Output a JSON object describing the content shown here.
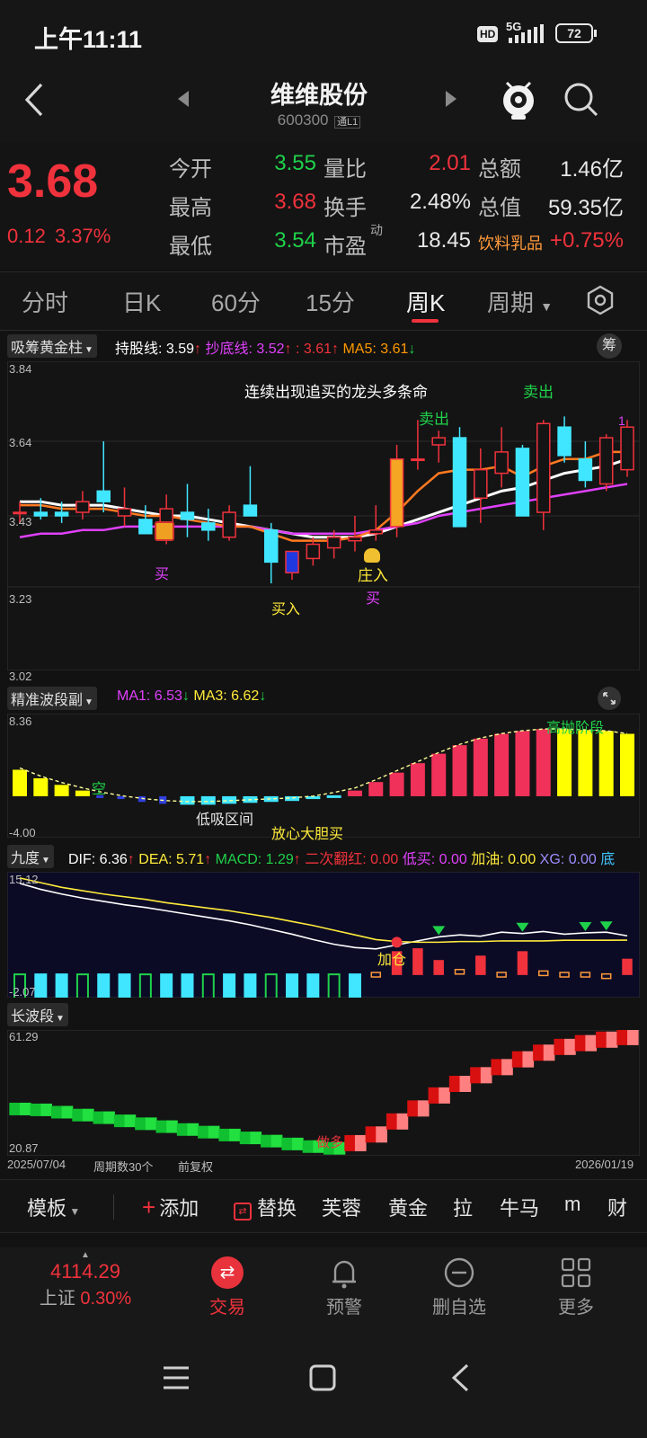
{
  "status": {
    "time": "上午11:11",
    "hd": "HD",
    "network": "5G",
    "battery": "72"
  },
  "nav": {
    "title": "维维股份",
    "code": "600300",
    "level": "通L1"
  },
  "quote": {
    "price": "3.68",
    "change": "0.12",
    "change_pct": "3.37%",
    "rows": [
      [
        {
          "l": "今开",
          "v": "3.55",
          "c": "green"
        },
        {
          "l": "量比",
          "v": "2.01",
          "c": "red"
        },
        {
          "l": "总额",
          "v": "1.46亿",
          "c": "white"
        }
      ],
      [
        {
          "l": "最高",
          "v": "3.68",
          "c": "red"
        },
        {
          "l": "换手",
          "v": "2.48%",
          "c": "white"
        },
        {
          "l": "总值",
          "v": "59.35亿",
          "c": "white"
        }
      ],
      [
        {
          "l": "最低",
          "v": "3.54",
          "c": "green"
        },
        {
          "l": "市盈",
          "v": "18.45",
          "c": "white"
        },
        {
          "l": "饮料乳品",
          "v": "+0.75%",
          "c": "red"
        }
      ]
    ],
    "pe_sup": "动"
  },
  "tabs": [
    "分时",
    "日K",
    "60分",
    "15分",
    "周K",
    "周期"
  ],
  "main_ind": {
    "name": "吸筹黄金柱",
    "items": [
      {
        "t": "持股线: 3.59",
        "c": "#ffffff"
      },
      {
        "t": "↑",
        "c": "#f0323c"
      },
      {
        "t": " 抄底线: 3.52",
        "c": "#e040fb"
      },
      {
        "t": "↑",
        "c": "#f0323c"
      },
      {
        "t": " : 3.61",
        "c": "#f0323c"
      },
      {
        "t": "↑",
        "c": "#f0323c"
      },
      {
        "t": " MA5: 3.61",
        "c": "#ff9800"
      },
      {
        "t": "↓",
        "c": "#1fd14a"
      }
    ],
    "chip": "筹",
    "axis": [
      "3.84",
      "3.64",
      "3.43",
      "3.23",
      "3.02"
    ],
    "annotations": {
      "headline": "连续出现追买的龙头多条命",
      "sell1": "卖出",
      "sell2": "卖出",
      "buy1": "买",
      "buy2": "买入",
      "zhuang": "庄入",
      "buy3": "买",
      "one": "1"
    }
  },
  "sub1": {
    "name": "精准波段副",
    "items": [
      {
        "t": "MA1: 6.53",
        "c": "#e040fb"
      },
      {
        "t": "↓",
        "c": "#1fd14a"
      },
      {
        "t": " MA3: 6.62",
        "c": "#ffeb3b"
      },
      {
        "t": "↓",
        "c": "#1fd14a"
      }
    ],
    "axis": [
      "8.36",
      "-4.00"
    ],
    "annotations": {
      "kong": "空",
      "low": "低吸区间",
      "bold": "放心大胆买",
      "high": "高抛阶段"
    }
  },
  "sub2": {
    "name": "九度",
    "items": [
      {
        "t": "DIF: 6.36",
        "c": "#ffffff"
      },
      {
        "t": "↑",
        "c": "#f0323c"
      },
      {
        "t": " DEA: 5.71",
        "c": "#ffeb3b"
      },
      {
        "t": "↑",
        "c": "#f0323c"
      },
      {
        "t": " MACD: 1.29",
        "c": "#1fd14a"
      },
      {
        "t": "↑",
        "c": "#f0323c"
      },
      {
        "t": " 二次翻红: 0.00",
        "c": "#f0323c"
      },
      {
        "t": " 低买: 0.00",
        "c": "#e040fb"
      },
      {
        "t": " 加油: 0.00",
        "c": "#ffeb3b"
      },
      {
        "t": " XG: 0.00",
        "c": "#9c8cff"
      },
      {
        "t": " 底",
        "c": "#40c4ff"
      }
    ],
    "axis": [
      "15.12",
      "-2.07"
    ],
    "annotations": {
      "jiacang": "加仓"
    }
  },
  "sub3": {
    "name": "长波段",
    "axis": [
      "61.29",
      "20.87"
    ],
    "annotations": {
      "zuoduo": "做多"
    }
  },
  "footer": {
    "start": "2025/07/04",
    "periods": "周期数30个",
    "adj": "前复权",
    "end": "2026/01/19"
  },
  "toolbar": [
    "模板",
    "添加",
    "替换",
    "芙蓉",
    "黄金",
    "拉",
    "牛马",
    "m",
    "财"
  ],
  "bottom": {
    "index_value": "4114.29",
    "index_name": "上证",
    "index_pct": "0.30%",
    "trade": "交易",
    "alert": "预警",
    "remove": "删自选",
    "more": "更多"
  },
  "colors": {
    "up": "#f0323c",
    "down": "#1fd14a",
    "cyan": "#40e6ff",
    "magenta": "#e040fb",
    "yellow": "#ffff00"
  },
  "chart_data": [
    {
      "type": "candlestick",
      "title": "周K",
      "ylim": [
        3.02,
        3.84
      ],
      "x": [
        "2025/07/04",
        "",
        "",
        "",
        "",
        "",
        "",
        "",
        "",
        "",
        "",
        "",
        "",
        "",
        "",
        "",
        "",
        "",
        "",
        "",
        "",
        "",
        "",
        "",
        "",
        "",
        "",
        "",
        "",
        "2026/01/19"
      ],
      "ohlc": [
        [
          3.44,
          3.47,
          3.41,
          3.44
        ],
        [
          3.44,
          3.48,
          3.42,
          3.43
        ],
        [
          3.44,
          3.47,
          3.41,
          3.43
        ],
        [
          3.44,
          3.5,
          3.42,
          3.47
        ],
        [
          3.5,
          3.64,
          3.44,
          3.47
        ],
        [
          3.43,
          3.51,
          3.4,
          3.45
        ],
        [
          3.42,
          3.46,
          3.38,
          3.38
        ],
        [
          3.4,
          3.49,
          3.35,
          3.45
        ],
        [
          3.44,
          3.52,
          3.37,
          3.42
        ],
        [
          3.41,
          3.45,
          3.36,
          3.39
        ],
        [
          3.37,
          3.46,
          3.36,
          3.44
        ],
        [
          3.46,
          3.57,
          3.43,
          3.43
        ],
        [
          3.39,
          3.41,
          3.24,
          3.3
        ],
        [
          3.27,
          3.33,
          3.25,
          3.33
        ],
        [
          3.31,
          3.37,
          3.29,
          3.35
        ],
        [
          3.34,
          3.39,
          3.31,
          3.37
        ],
        [
          3.36,
          3.43,
          3.33,
          3.37
        ],
        [
          3.38,
          3.46,
          3.36,
          3.39
        ],
        [
          3.4,
          3.63,
          3.37,
          3.59
        ],
        [
          3.59,
          3.7,
          3.56,
          3.59
        ],
        [
          3.63,
          3.67,
          3.58,
          3.65
        ],
        [
          3.65,
          3.68,
          3.54,
          3.4
        ],
        [
          3.48,
          3.62,
          3.41,
          3.56
        ],
        [
          3.55,
          3.68,
          3.51,
          3.61
        ],
        [
          3.62,
          3.63,
          3.44,
          3.43
        ],
        [
          3.44,
          3.7,
          3.39,
          3.69
        ],
        [
          3.68,
          3.71,
          3.58,
          3.6
        ],
        [
          3.59,
          3.64,
          3.51,
          3.53
        ],
        [
          3.52,
          3.66,
          3.5,
          3.65
        ],
        [
          3.56,
          3.7,
          3.54,
          3.68
        ]
      ],
      "series": [
        {
          "name": "持股线",
          "values": [
            3.47,
            3.47,
            3.46,
            3.46,
            3.46,
            3.45,
            3.44,
            3.43,
            3.43,
            3.42,
            3.41,
            3.4,
            3.39,
            3.38,
            3.37,
            3.37,
            3.37,
            3.38,
            3.4,
            3.42,
            3.44,
            3.46,
            3.48,
            3.5,
            3.51,
            3.53,
            3.55,
            3.56,
            3.57,
            3.59
          ]
        },
        {
          "name": "抄底线",
          "values": [
            3.37,
            3.38,
            3.38,
            3.39,
            3.39,
            3.4,
            3.4,
            3.4,
            3.4,
            3.4,
            3.4,
            3.4,
            3.39,
            3.38,
            3.38,
            3.38,
            3.38,
            3.39,
            3.4,
            3.41,
            3.43,
            3.44,
            3.45,
            3.46,
            3.47,
            3.48,
            3.49,
            3.5,
            3.51,
            3.52
          ]
        },
        {
          "name": "MA5",
          "values": [
            3.46,
            3.46,
            3.45,
            3.45,
            3.45,
            3.44,
            3.43,
            3.43,
            3.42,
            3.41,
            3.4,
            3.4,
            3.38,
            3.36,
            3.36,
            3.36,
            3.37,
            3.39,
            3.44,
            3.5,
            3.55,
            3.56,
            3.56,
            3.57,
            3.54,
            3.57,
            3.59,
            3.59,
            3.61,
            3.61
          ]
        }
      ]
    },
    {
      "type": "bar",
      "title": "精准波段副",
      "ylim": [
        -4.0,
        8.36
      ],
      "values": [
        2.8,
        1.9,
        1.2,
        0.6,
        0.1,
        -0.3,
        -0.6,
        -0.8,
        -0.9,
        -0.9,
        -0.8,
        -0.7,
        -0.6,
        -0.5,
        -0.3,
        0.1,
        0.6,
        1.5,
        2.5,
        3.5,
        4.5,
        5.4,
        6.1,
        6.6,
        6.9,
        7.1,
        7.1,
        7.0,
        6.9,
        6.6
      ]
    },
    {
      "type": "bar",
      "title": "九度",
      "ylim": [
        -2.07,
        15.12
      ],
      "series": [
        {
          "name": "DIF",
          "values": [
            14.2,
            13.3,
            12.6,
            12.0,
            11.5,
            11.0,
            10.6,
            10.1,
            9.6,
            9.1,
            8.6,
            8.0,
            7.3,
            6.6,
            5.8,
            5.1,
            4.6,
            4.4,
            5.0,
            5.6,
            6.2,
            6.5,
            6.3,
            6.9,
            6.7,
            7.0,
            6.6,
            6.8,
            6.9,
            6.36
          ]
        },
        {
          "name": "DEA",
          "values": [
            15.0,
            14.3,
            13.6,
            13.1,
            12.6,
            12.2,
            11.8,
            11.3,
            10.9,
            10.5,
            10.1,
            9.6,
            9.1,
            8.5,
            7.9,
            7.2,
            6.5,
            5.8,
            5.5,
            5.4,
            5.4,
            5.5,
            5.5,
            5.6,
            5.6,
            5.6,
            5.7,
            5.7,
            5.7,
            5.71
          ]
        },
        {
          "name": "MACD",
          "values": [
            -1.8,
            -1.9,
            -1.9,
            -1.9,
            -1.9,
            -1.9,
            -1.9,
            -1.8,
            -1.8,
            -1.8,
            -1.8,
            -1.8,
            -1.8,
            -1.7,
            -1.6,
            -1.5,
            -0.8,
            0.4,
            1.8,
            2.0,
            1.2,
            0.6,
            1.5,
            0.4,
            1.8,
            0.5,
            0.4,
            0.4,
            0.3,
            1.29
          ]
        }
      ]
    },
    {
      "type": "bar",
      "title": "长波段",
      "ylim": [
        20.87,
        61.29
      ],
      "values": [
        35.5,
        35.2,
        34.4,
        33.4,
        32.5,
        31.4,
        30.4,
        29.4,
        28.4,
        27.5,
        26.5,
        25.5,
        24.4,
        23.4,
        22.5,
        21.9,
        24.0,
        27.0,
        31.5,
        36.0,
        40.5,
        44.5,
        47.5,
        50.3,
        53.0,
        55.3,
        57.3,
        58.6,
        59.8,
        60.7
      ]
    }
  ]
}
